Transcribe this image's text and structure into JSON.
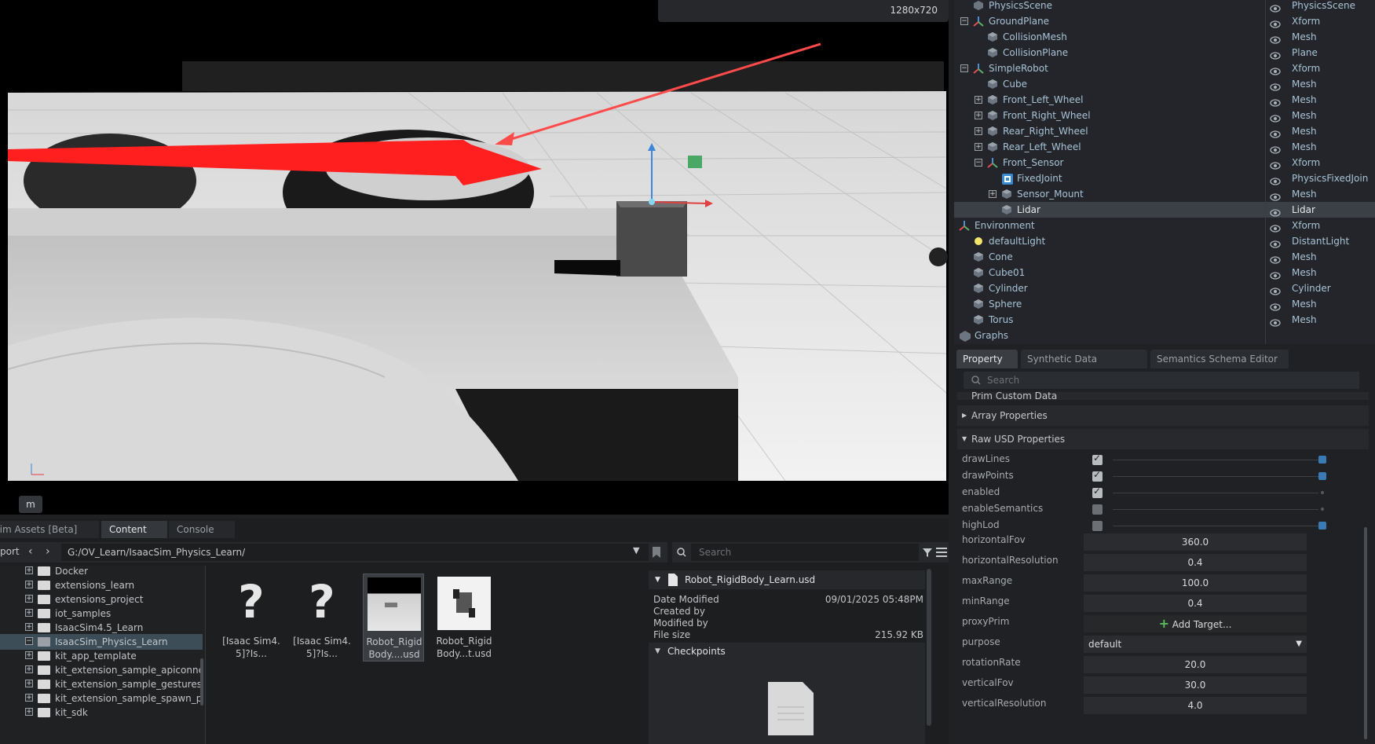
{
  "viewport": {
    "resolution": "1280x720",
    "view_mode": "m"
  },
  "stage": {
    "rows": [
      {
        "name": "PhysicsScene",
        "type": "PhysicsScene",
        "depth": 1,
        "icon": "physics-scene-icon"
      },
      {
        "name": "GroundPlane",
        "type": "Xform",
        "depth": 1,
        "icon": "xform-icon",
        "expander": "minus"
      },
      {
        "name": "CollisionMesh",
        "type": "Mesh",
        "depth": 2,
        "icon": "mesh-icon"
      },
      {
        "name": "CollisionPlane",
        "type": "Plane",
        "depth": 2,
        "icon": "mesh-icon"
      },
      {
        "name": "SimpleRobot",
        "type": "Xform",
        "depth": 1,
        "icon": "xform-icon",
        "expander": "minus"
      },
      {
        "name": "Cube",
        "type": "Mesh",
        "depth": 2,
        "icon": "mesh-icon"
      },
      {
        "name": "Front_Left_Wheel",
        "type": "Mesh",
        "depth": 2,
        "icon": "mesh-icon",
        "expander": "plus"
      },
      {
        "name": "Front_Right_Wheel",
        "type": "Mesh",
        "depth": 2,
        "icon": "mesh-icon",
        "expander": "plus"
      },
      {
        "name": "Rear_Right_Wheel",
        "type": "Mesh",
        "depth": 2,
        "icon": "mesh-icon",
        "expander": "plus"
      },
      {
        "name": "Rear_Left_Wheel",
        "type": "Mesh",
        "depth": 2,
        "icon": "mesh-icon",
        "expander": "plus"
      },
      {
        "name": "Front_Sensor",
        "type": "Xform",
        "depth": 2,
        "icon": "xform-icon",
        "expander": "minus"
      },
      {
        "name": "FixedJoint",
        "type": "PhysicsFixedJoin",
        "depth": 3,
        "icon": "joint-icon"
      },
      {
        "name": "Sensor_Mount",
        "type": "Mesh",
        "depth": 3,
        "icon": "mesh-icon",
        "expander": "plus"
      },
      {
        "name": "Lidar",
        "type": "Lidar",
        "depth": 3,
        "icon": "mesh-icon",
        "selected": true
      },
      {
        "name": "Environment",
        "type": "Xform",
        "depth": 0,
        "icon": "xform-icon",
        "expander": "minus"
      },
      {
        "name": "defaultLight",
        "type": "DistantLight",
        "depth": 1,
        "icon": "light-icon"
      },
      {
        "name": "Cone",
        "type": "Mesh",
        "depth": 1,
        "icon": "mesh-icon"
      },
      {
        "name": "Cube01",
        "type": "Mesh",
        "depth": 1,
        "icon": "mesh-icon"
      },
      {
        "name": "Cylinder",
        "type": "Cylinder",
        "depth": 1,
        "icon": "mesh-icon"
      },
      {
        "name": "Sphere",
        "type": "Mesh",
        "depth": 1,
        "icon": "mesh-icon"
      },
      {
        "name": "Torus",
        "type": "Mesh",
        "depth": 1,
        "icon": "mesh-icon"
      },
      {
        "name": "Graphs",
        "type": "",
        "depth": 0,
        "icon": "graph-icon",
        "expander": "plus"
      }
    ]
  },
  "property": {
    "tabs": [
      "Property",
      "Synthetic Data Recorder",
      "Semantics Schema Editor"
    ],
    "search_placeholder": "Search",
    "sections": {
      "prim_custom": "Prim Custom Data",
      "array": "Array Properties",
      "raw_usd": "Raw USD Properties"
    },
    "checkbox_props": [
      {
        "label": "drawLines",
        "checked": true
      },
      {
        "label": "drawPoints",
        "checked": true
      },
      {
        "label": "enabled",
        "checked": true
      },
      {
        "label": "enableSemantics",
        "checked": false
      },
      {
        "label": "highLod",
        "checked": false
      }
    ],
    "value_props": [
      {
        "label": "horizontalFov",
        "value": "360.0"
      },
      {
        "label": "horizontalResolution",
        "value": "0.4"
      },
      {
        "label": "maxRange",
        "value": "100.0"
      },
      {
        "label": "minRange",
        "value": "0.4"
      },
      {
        "label": "proxyPrim",
        "value": "Add Target..."
      },
      {
        "label": "purpose",
        "value": "default"
      },
      {
        "label": "rotationRate",
        "value": "20.0"
      },
      {
        "label": "verticalFov",
        "value": "30.0"
      },
      {
        "label": "verticalResolution",
        "value": "4.0"
      }
    ]
  },
  "content": {
    "tabs": [
      "Sim Assets [Beta]",
      "Content",
      "Console"
    ],
    "left_stub": "port",
    "path": "G:/OV_Learn/IsaacSim_Physics_Learn/",
    "search_placeholder": "Search",
    "tree": [
      {
        "label": "Docker"
      },
      {
        "label": "extensions_learn"
      },
      {
        "label": "extensions_project"
      },
      {
        "label": "iot_samples"
      },
      {
        "label": "IsaacSim4.5_Learn"
      },
      {
        "label": "IsaacSim_Physics_Learn",
        "selected": true
      },
      {
        "label": "kit_app_template"
      },
      {
        "label": "kit_extension_sample_apiconne"
      },
      {
        "label": "kit_extension_sample_gestures"
      },
      {
        "label": "kit_extension_sample_spawn_pi"
      },
      {
        "label": "kit_sdk"
      }
    ],
    "files": [
      {
        "line1": "[Isaac Sim4.",
        "line2": "5]?Is...",
        "kind": "unknown"
      },
      {
        "line1": "[Isaac Sim4.",
        "line2": "5]?Is...",
        "kind": "unknown"
      },
      {
        "line1": "Robot_Rigid",
        "line2": "Body....usd",
        "kind": "scene",
        "selected": true
      },
      {
        "line1": "Robot_Rigid",
        "line2": "Body...t.usd",
        "kind": "robot"
      }
    ],
    "details": {
      "filename": "Robot_RigidBody_Learn.usd",
      "date_modified_label": "Date Modified",
      "date_modified": "09/01/2025 05:48PM",
      "created_by_label": "Created by",
      "modified_by_label": "Modified by",
      "file_size_label": "File size",
      "file_size": "215.92 KB",
      "checkpoints_label": "Checkpoints"
    }
  },
  "colors": {
    "accent": "#3a7ab5",
    "arrow": "#ff2b2b"
  }
}
